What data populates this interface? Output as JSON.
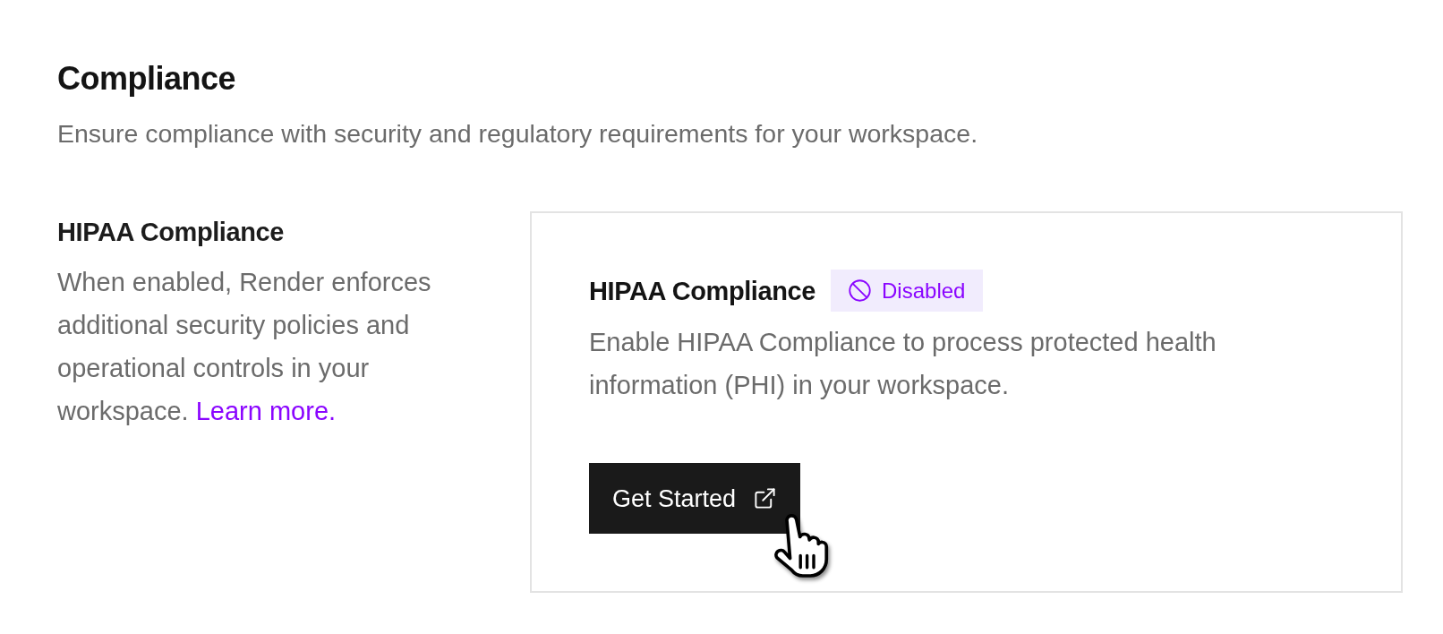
{
  "page": {
    "title": "Compliance",
    "description": "Ensure compliance with security and regulatory requirements for your workspace."
  },
  "sections": [
    {
      "title": "HIPAA Compliance",
      "description": "When enabled, Render enforces additional security policies and operational controls in your workspace.",
      "link": "Learn more.",
      "card": {
        "title": "HIPAA Compliance",
        "status": {
          "kind": "disabled",
          "label": "Disabled"
        },
        "description": "Enable HIPAA Compliance to process protected health information (PHI) in your workspace.",
        "button": {
          "label": "Get Started"
        }
      }
    }
  ]
}
